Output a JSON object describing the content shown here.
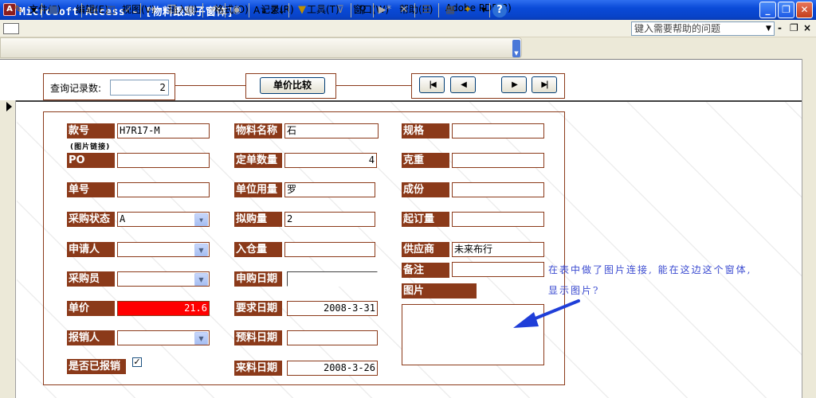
{
  "window": {
    "title": "Microsoft Access - [物料跟踪子窗体]",
    "app_icon_glyph": "A",
    "buttons": {
      "minimize": "_",
      "restore": "❐",
      "close": "✕"
    }
  },
  "menu": {
    "items": [
      "文件(F)",
      "编辑(E)",
      "视图(V)",
      "插入(I)",
      "格式(O)",
      "记录(R)",
      "工具(T)",
      "窗口(W)",
      "帮助(H)",
      "Adobe PDF(B)"
    ],
    "help_placeholder": "键入需要帮助的问题",
    "mdi_buttons": {
      "minimize": "-",
      "restore": "❐",
      "close": "×"
    }
  },
  "toolbar": {
    "icons": [
      "view-icon",
      "save-icon",
      "search-file-icon",
      "print-icon",
      "print-preview-icon",
      "spelling-icon",
      "cut-icon",
      "copy-icon",
      "paste-icon",
      "undo-icon",
      "hyperlink-icon",
      "sort-ascending-icon",
      "sort-descending-icon",
      "filter-selection-icon",
      "filter-form-icon",
      "apply-filter-icon",
      "find-icon",
      "new-record-icon",
      "delete-record-icon",
      "properties-icon",
      "database-window-icon",
      "new-object-icon",
      "help-icon"
    ]
  },
  "header": {
    "query_count_label": "查询记录数:",
    "query_count_value": "2",
    "compare_button": "单价比较",
    "nav": {
      "first": "|◀",
      "prev": "◀",
      "next": "▶",
      "last": "▶|"
    }
  },
  "record": {
    "style_no": {
      "label": "款号",
      "value": "H7R17-M"
    },
    "picture_link_note": "(图片链接)",
    "po": {
      "label": "PO",
      "value": ""
    },
    "order_no": {
      "label": "单号",
      "value": ""
    },
    "purchase_status": {
      "label": "采购状态",
      "value": "A"
    },
    "applicant": {
      "label": "申请人",
      "value": ""
    },
    "buyer": {
      "label": "采购员",
      "value": ""
    },
    "unit_price": {
      "label": "单价",
      "value": "21.6"
    },
    "reimburser": {
      "label": "报销人",
      "value": ""
    },
    "reimbursed": {
      "label": "是否已报销",
      "checked_glyph": "✓"
    },
    "material_name": {
      "label": "物料名称",
      "value": "石"
    },
    "order_qty": {
      "label": "定单数量",
      "value": "4"
    },
    "unit_usage": {
      "label": "单位用量",
      "value": "罗"
    },
    "planned_qty": {
      "label": "拟购量",
      "value": "2"
    },
    "stock_in": {
      "label": "入仓量",
      "value": ""
    },
    "purchase_date": {
      "label": "申购日期",
      "value": ""
    },
    "required_date": {
      "label": "要求日期",
      "value": "2008-3-31"
    },
    "expected_date": {
      "label": "预料日期",
      "value": ""
    },
    "arrival_date": {
      "label": "来料日期",
      "value": "2008-3-26"
    },
    "spec": {
      "label": "规格",
      "value": ""
    },
    "gram_weight": {
      "label": "克重",
      "value": ""
    },
    "cost": {
      "label": "成份",
      "value": ""
    },
    "moq": {
      "label": "起订量",
      "value": ""
    },
    "supplier": {
      "label": "供应商",
      "value": "未来布行"
    },
    "remark": {
      "label": "备注",
      "value": ""
    },
    "picture": {
      "label": "图片"
    }
  },
  "annotation": {
    "line1": "在表中做了图片连接, 能在这边这个窗体,",
    "line2": "显示图片?",
    "arrow_color": "#1f3ed8"
  },
  "colors": {
    "label_bg": "#8b3a1a",
    "price_bg": "#ff0000",
    "titlebar": "#0a4ad8"
  }
}
